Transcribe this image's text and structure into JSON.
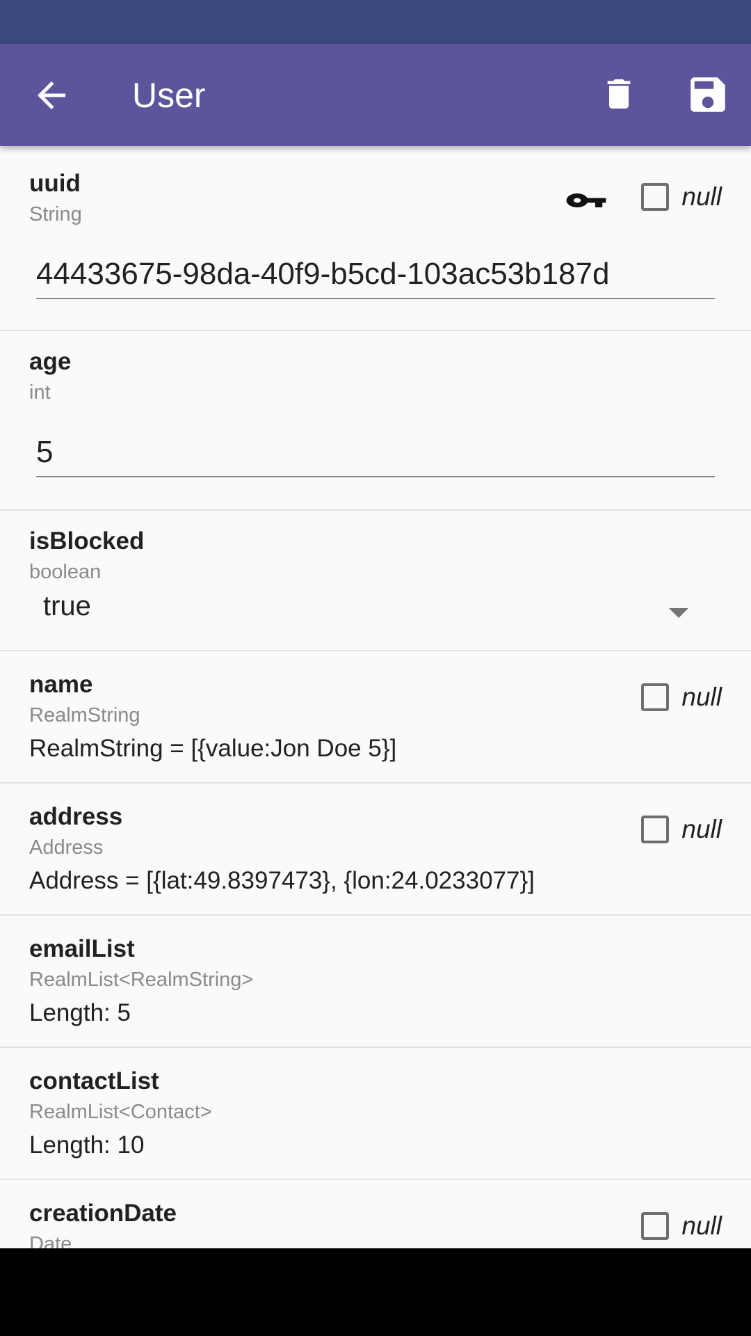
{
  "app_bar": {
    "title": "User"
  },
  "fields": {
    "uuid": {
      "name": "uuid",
      "type": "String",
      "value": "44433675-98da-40f9-b5cd-103ac53b187d",
      "null_label": "null"
    },
    "age": {
      "name": "age",
      "type": "int",
      "value": "5"
    },
    "isBlocked": {
      "name": "isBlocked",
      "type": "boolean",
      "value": "true"
    },
    "name": {
      "name": "name",
      "type": "RealmString",
      "value": "RealmString = [{value:Jon Doe 5}]",
      "null_label": "null"
    },
    "address": {
      "name": "address",
      "type": "Address",
      "value": "Address = [{lat:49.8397473}, {lon:24.0233077}]",
      "null_label": "null"
    },
    "emailList": {
      "name": "emailList",
      "type": "RealmList<RealmString>",
      "value": "Length: 5"
    },
    "contactList": {
      "name": "contactList",
      "type": "RealmList<Contact>",
      "value": "Length: 10"
    },
    "creationDate": {
      "name": "creationDate",
      "type": "Date",
      "null_label": "null"
    }
  },
  "colors": {
    "status_bar": "#3a4a7e",
    "app_bar": "#5c559c",
    "background": "#fafafa"
  },
  "icons": [
    "arrow-back-icon",
    "delete-icon",
    "save-icon",
    "key-icon",
    "dropdown-caret-icon"
  ]
}
